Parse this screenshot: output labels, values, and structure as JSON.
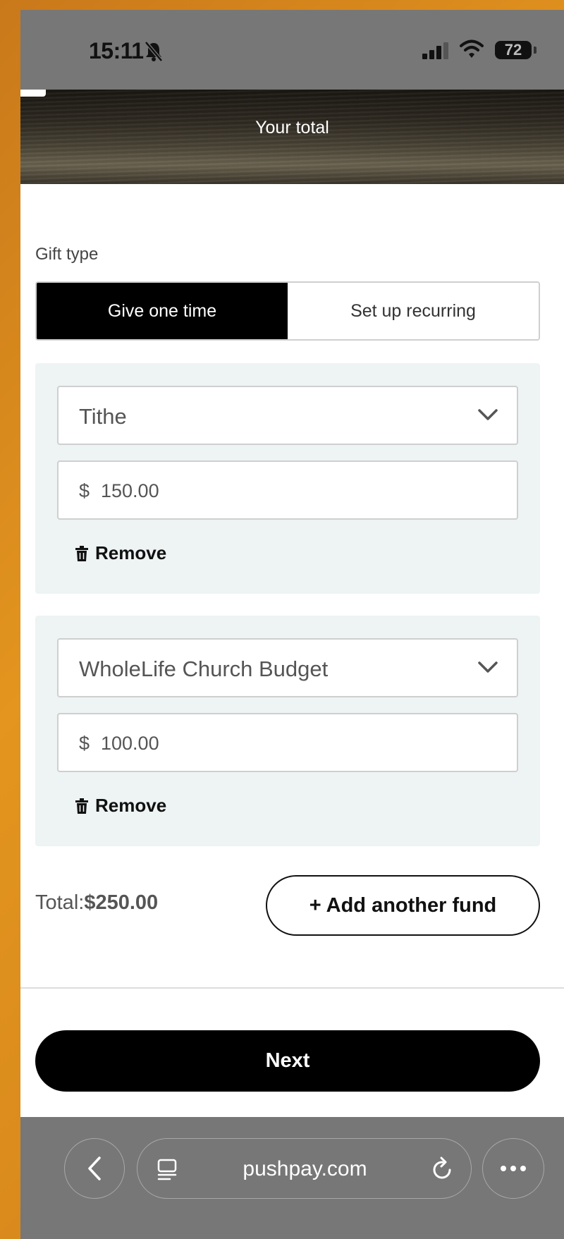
{
  "status_bar": {
    "time": "15:11",
    "battery": "72"
  },
  "hero": {
    "title": "Your total"
  },
  "gift_type": {
    "label": "Gift type",
    "options": [
      "Give one time",
      "Set up recurring"
    ],
    "selected": "Give one time"
  },
  "funds": [
    {
      "name": "Tithe",
      "currency": "$",
      "amount": "150.00",
      "remove_label": "Remove"
    },
    {
      "name": "WholeLife Church Budget",
      "currency": "$",
      "amount": "100.00",
      "remove_label": "Remove"
    }
  ],
  "summary": {
    "total_label": "Total:",
    "total_value": "$250.00",
    "add_fund_label": "+ Add another fund"
  },
  "next_label": "Next",
  "browser": {
    "url": "pushpay.com"
  },
  "colors": {
    "primary": "#000000",
    "card_background": "#eef3f3",
    "chrome": "#777777"
  }
}
